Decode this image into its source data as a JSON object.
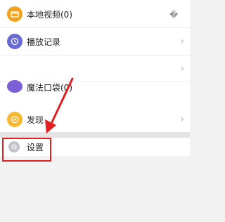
{
  "colors": {
    "folder_icon": "#f2a31b",
    "history_icon": "#6a6ad6",
    "pocket_icon": "#7c5fd6",
    "discover_icon": "#f5b830",
    "settings_icon": "#bfc2c7",
    "annotation": "#e02020"
  },
  "menu": {
    "items": [
      {
        "label": "本地视频(0)",
        "icon": "folder-icon"
      },
      {
        "label": "播放记录",
        "icon": "clock-icon"
      },
      {
        "label": "",
        "icon": ""
      },
      {
        "label": "魔法口袋(0)",
        "icon": "pocket-icon"
      },
      {
        "label": "发现",
        "icon": "discover-icon"
      }
    ],
    "chevron": "›"
  },
  "settings": {
    "label": "设置",
    "icon": "gear-icon"
  },
  "side_glyph": "�"
}
